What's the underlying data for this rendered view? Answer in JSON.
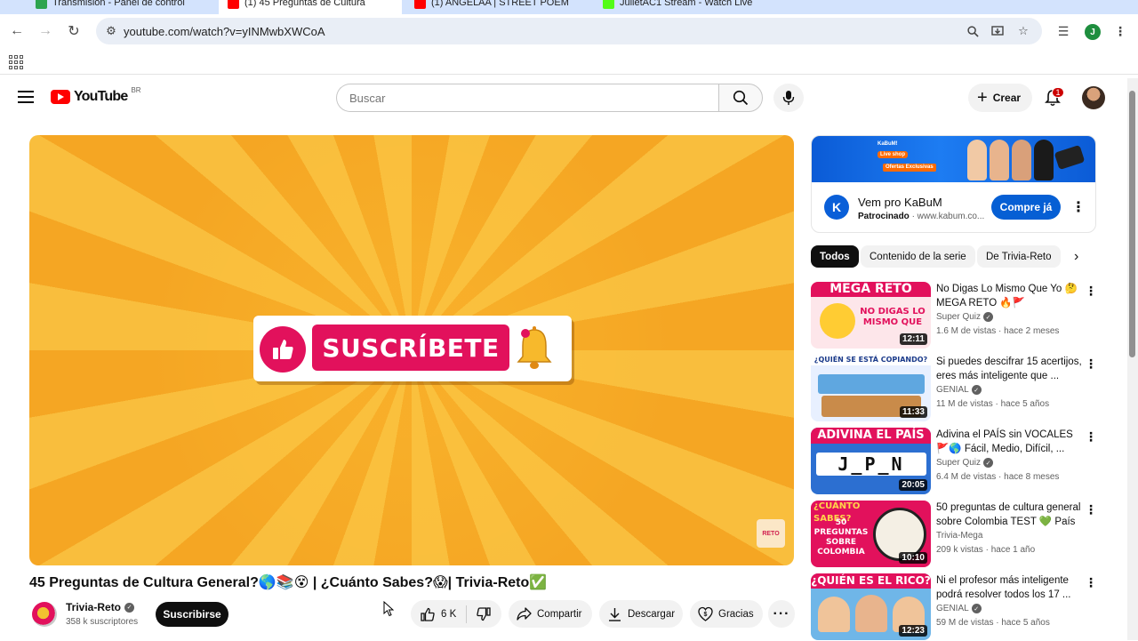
{
  "browser": {
    "tabs": [
      {
        "label": "Transmisión - Panel de control",
        "active": false,
        "favicon_color": "#2da44e"
      },
      {
        "label": "(1) 45 Preguntas de Cultura",
        "active": true,
        "favicon_color": "#ff0000"
      },
      {
        "label": "(1) ANGELAA | STREET POEM",
        "active": false,
        "favicon_color": "#ff0000"
      },
      {
        "label": "JulietAC1 Stream - Watch Live",
        "active": false,
        "favicon_color": "#53fc18"
      }
    ],
    "url": "youtube.com/watch?v=yINMwbXWCoA",
    "profile_initial": "J"
  },
  "header": {
    "logo_text": "YouTube",
    "country_code": "BR",
    "search_placeholder": "Buscar",
    "create_label": "Crear",
    "notification_count": "1"
  },
  "player": {
    "overlay_text": "SUSCRÍBETE",
    "watermark_text": "RETO"
  },
  "video": {
    "title": "45 Preguntas de Cultura General?🌎📚😵 | ¿Cuánto Sabes?😱| Trivia-Reto✅",
    "channel_name": "Trivia-Reto",
    "subscribers": "358 k suscriptores",
    "subscribe_label": "Suscribirse",
    "likes": "6 K",
    "share_label": "Compartir",
    "download_label": "Descargar",
    "thanks_label": "Gracias"
  },
  "ad": {
    "banner_tag": "KaBuM!",
    "banner_live": "Live shop",
    "banner_offer": "Ofertas Exclusivas",
    "title": "Vem pro KaBuM",
    "sponsored": "Patrocinado",
    "domain": "· www.kabum.co...",
    "cta": "Compre já",
    "logo_letter": "K"
  },
  "chips": [
    "Todos",
    "Contenido de la serie",
    "De Trivia-Reto"
  ],
  "recommendations": [
    {
      "thumb_text": "MEGA RETO",
      "thumb_sub": "NO DIGAS LO MISMO QUE",
      "duration": "12:11",
      "title": "No Digas Lo Mismo Que Yo 🤔 MEGA RETO 🔥🚩",
      "channel": "Super Quiz",
      "meta": "1.6 M de vistas · hace 2 meses"
    },
    {
      "thumb_text": "¿QUIÉN SE ESTÁ COPIANDO?",
      "thumb_sub": "",
      "duration": "11:33",
      "title": "Si puedes descifrar 15 acertijos, eres más inteligente que ...",
      "channel": "GENIAL",
      "meta": "11 M de vistas · hace 5 años"
    },
    {
      "thumb_text": "ADIVINA EL PAÍS",
      "thumb_sub": "J_P_N",
      "duration": "20:05",
      "title": "Adivina el PAÍS sin VOCALES 🚩🌎 Fácil, Medio, Difícil, ...",
      "channel": "Super Quiz",
      "meta": "6.4 M de vistas · hace 8 meses"
    },
    {
      "thumb_text": "¿CUÁNTO SABES?",
      "thumb_sub": "50 PREGUNTAS SOBRE COLOMBIA",
      "duration": "10:10",
      "title": "50 preguntas de cultura general sobre Colombia TEST 💚 País ...",
      "channel": "Trivia-Mega",
      "meta": "209 k vistas · hace 1 año"
    },
    {
      "thumb_text": "¿QUIÉN ES EL RICO?",
      "thumb_sub": "",
      "duration": "12:23",
      "title": "Ni el profesor más inteligente podrá resolver todos los 17 ...",
      "channel": "GENIAL",
      "meta": "59 M de vistas · hace 5 años"
    }
  ]
}
